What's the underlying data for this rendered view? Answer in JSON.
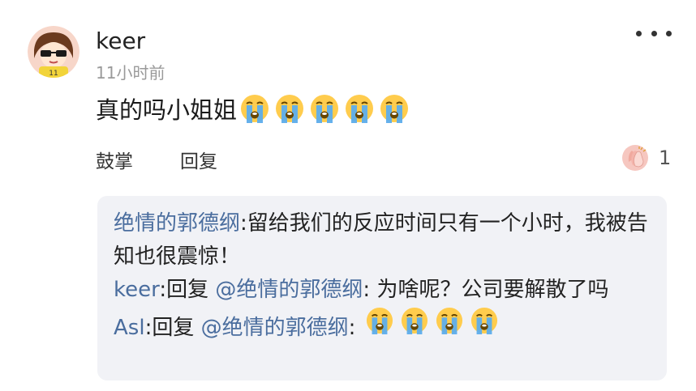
{
  "comment": {
    "username": "keer",
    "timestamp": "11小时前",
    "text": "真的吗小姐姐",
    "emojis": [
      "crying-face",
      "crying-face",
      "crying-face",
      "crying-face",
      "crying-face"
    ],
    "actions": {
      "applaud_label": "鼓掌",
      "reply_label": "回复",
      "like_count": "1"
    }
  },
  "replies": [
    {
      "user": "绝情的郭德纲",
      "sep": ":",
      "text": "留给我们的反应时间只有一个小时，我被告知也很震惊！"
    },
    {
      "user": "keer",
      "sep": ":",
      "reply_word": "回复",
      "mention": "@绝情的郭德纲",
      "sep2": ":",
      "text": " 为啥呢？公司要解散了吗"
    },
    {
      "user": "Asl",
      "sep": ":",
      "reply_word": "回复",
      "mention": "@绝情的郭德纲",
      "sep2": ":",
      "emojis": [
        "crying-face",
        "crying-face",
        "crying-face",
        "crying-face"
      ]
    }
  ],
  "colors": {
    "link_blue": "#4a6d9e",
    "reply_bg": "#f1f2f6",
    "timestamp_gray": "#9a9a9a"
  }
}
